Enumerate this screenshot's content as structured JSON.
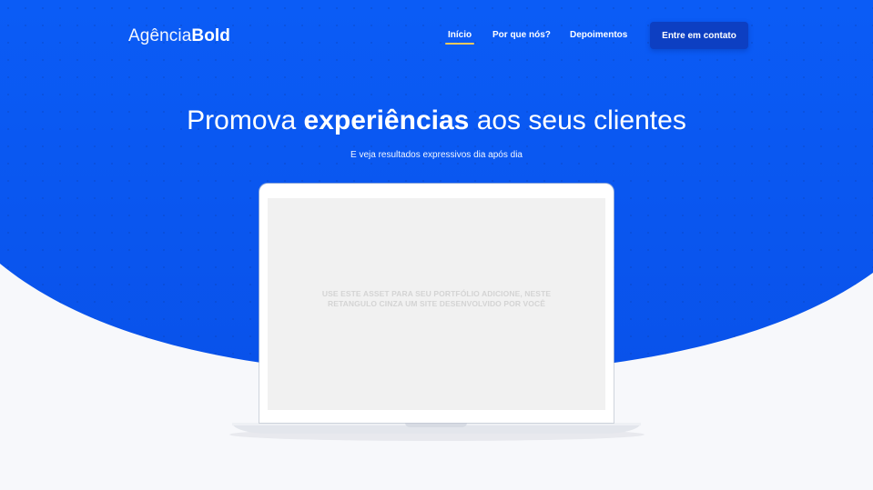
{
  "brand": {
    "logo_light": "Agência",
    "logo_bold": "Bold"
  },
  "nav": {
    "items": [
      {
        "label": "Início",
        "active": true
      },
      {
        "label": "Por que nós?",
        "active": false
      },
      {
        "label": "Depoimentos",
        "active": false
      }
    ],
    "cta_label": "Entre em contato"
  },
  "hero": {
    "headline_part1": "Promova",
    "headline_strong": "experiências",
    "headline_part2": "aos seus clientes",
    "subline": "E veja resultados expressivos dia após dia"
  },
  "mockup": {
    "screen_line1": "USE ESTE ASSET PARA SEU PORTFÓLIO ADICIONE, NESTE",
    "screen_line2": "RETANGULO CINZA UM SITE DESENVOLVIDO POR VOCÊ"
  },
  "colors": {
    "hero_blue": "#0a5cf5",
    "cta_blue": "#0d3fc2",
    "active_underline": "#f4c95d",
    "page_background": "#f7f8fb",
    "screen_placeholder": "#f1f1f1"
  }
}
